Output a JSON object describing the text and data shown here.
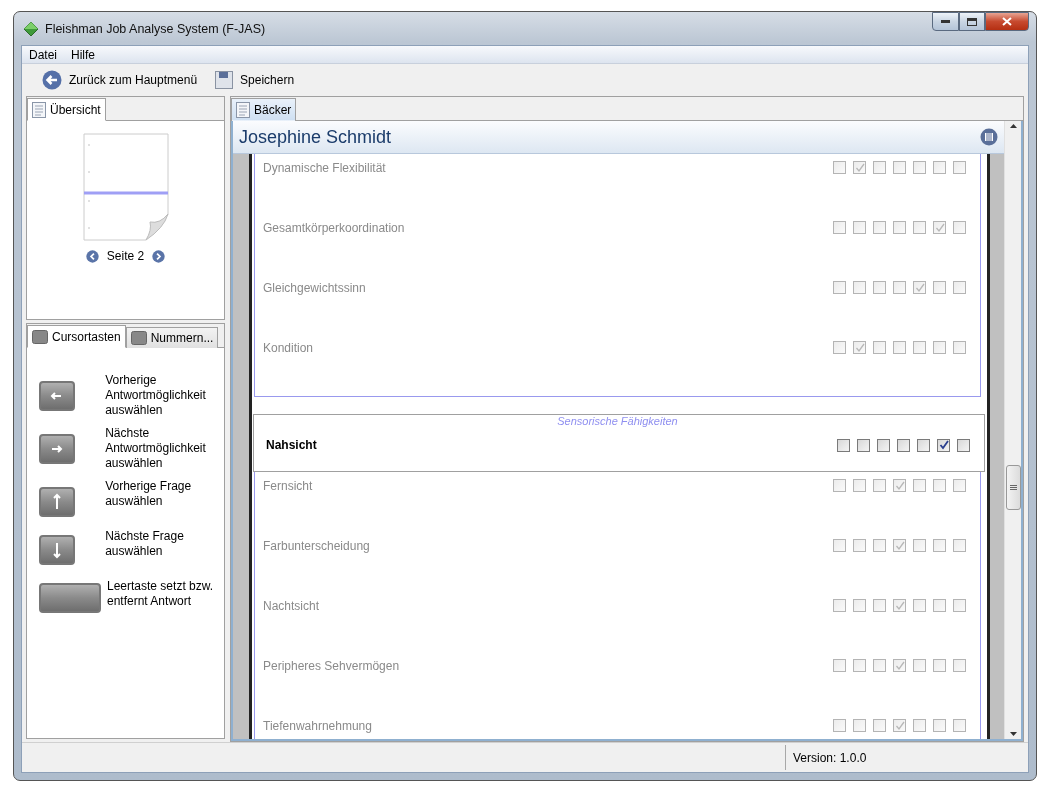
{
  "window": {
    "title": "Fleishman Job Analyse System (F-JAS)"
  },
  "menu": [
    "Datei",
    "Hilfe"
  ],
  "toolbar": [
    {
      "kind": "back",
      "label": "Zurück zum Hauptmenü"
    },
    {
      "kind": "save",
      "label": "Speichern"
    }
  ],
  "overview": {
    "tab": "Übersicht",
    "page_label": "Seite 2"
  },
  "shortcuts": {
    "tabs": [
      {
        "label": "Cursortasten",
        "selected": true
      },
      {
        "label": "Nummern...",
        "selected": false
      }
    ],
    "items": [
      {
        "kind": "left",
        "text": "Vorherige Antwortmöglichkeit auswählen"
      },
      {
        "kind": "right",
        "text": "Nächste Antwortmöglichkeit auswählen"
      },
      {
        "kind": "up",
        "text": "Vorherige Frage auswählen"
      },
      {
        "kind": "down",
        "text": "Nächste Frage auswählen"
      },
      {
        "kind": "space",
        "text": "Leertaste setzt bzw. entfernt Antwort"
      }
    ]
  },
  "document": {
    "tab": "Bäcker",
    "person": "Josephine Schmidt",
    "groups": [
      {
        "items": [
          {
            "name": "Dynamische Flexibilität",
            "active": false,
            "options": [
              {
                "checked": false
              },
              {
                "checked": true
              },
              {
                "checked": false
              },
              {
                "checked": false
              },
              {
                "checked": false
              },
              {
                "checked": false
              },
              {
                "checked": false
              }
            ]
          },
          {
            "name": "Gesamtkörperkoordination",
            "active": false,
            "options": [
              {
                "checked": false
              },
              {
                "checked": false
              },
              {
                "checked": false
              },
              {
                "checked": false
              },
              {
                "checked": false
              },
              {
                "checked": true
              },
              {
                "checked": false
              }
            ]
          },
          {
            "name": "Gleichgewichtssinn",
            "active": false,
            "options": [
              {
                "checked": false
              },
              {
                "checked": false
              },
              {
                "checked": false
              },
              {
                "checked": false
              },
              {
                "checked": true
              },
              {
                "checked": false
              },
              {
                "checked": false
              }
            ]
          },
          {
            "name": "Kondition",
            "active": false,
            "options": [
              {
                "checked": false
              },
              {
                "checked": true
              },
              {
                "checked": false
              },
              {
                "checked": false
              },
              {
                "checked": false
              },
              {
                "checked": false
              },
              {
                "checked": false
              }
            ]
          }
        ]
      },
      {
        "title": "Sensorische Fähigkeiten",
        "items": [
          {
            "name": "Nahsicht",
            "active": true,
            "options": [
              {
                "checked": false
              },
              {
                "checked": false
              },
              {
                "checked": false
              },
              {
                "checked": false
              },
              {
                "checked": false
              },
              {
                "checked": true
              },
              {
                "checked": false
              }
            ]
          },
          {
            "name": "Fernsicht",
            "active": false,
            "options": [
              {
                "checked": false
              },
              {
                "checked": false
              },
              {
                "checked": false
              },
              {
                "checked": true
              },
              {
                "checked": false
              },
              {
                "checked": false
              },
              {
                "checked": false
              }
            ]
          },
          {
            "name": "Farbunterscheidung",
            "active": false,
            "options": [
              {
                "checked": false
              },
              {
                "checked": false
              },
              {
                "checked": false
              },
              {
                "checked": true
              },
              {
                "checked": false
              },
              {
                "checked": false
              },
              {
                "checked": false
              }
            ]
          },
          {
            "name": "Nachtsicht",
            "active": false,
            "options": [
              {
                "checked": false
              },
              {
                "checked": false
              },
              {
                "checked": false
              },
              {
                "checked": true
              },
              {
                "checked": false
              },
              {
                "checked": false
              },
              {
                "checked": false
              }
            ]
          },
          {
            "name": "Peripheres Sehvermögen",
            "active": false,
            "options": [
              {
                "checked": false
              },
              {
                "checked": false
              },
              {
                "checked": false
              },
              {
                "checked": true
              },
              {
                "checked": false
              },
              {
                "checked": false
              },
              {
                "checked": false
              }
            ]
          },
          {
            "name": "Tiefenwahrnehmung",
            "active": false,
            "options": [
              {
                "checked": false
              },
              {
                "checked": false
              },
              {
                "checked": false
              },
              {
                "checked": true
              },
              {
                "checked": false
              },
              {
                "checked": false
              },
              {
                "checked": false
              }
            ]
          }
        ]
      }
    ]
  },
  "status_bar": {
    "version": "Version: 1.0.0"
  }
}
